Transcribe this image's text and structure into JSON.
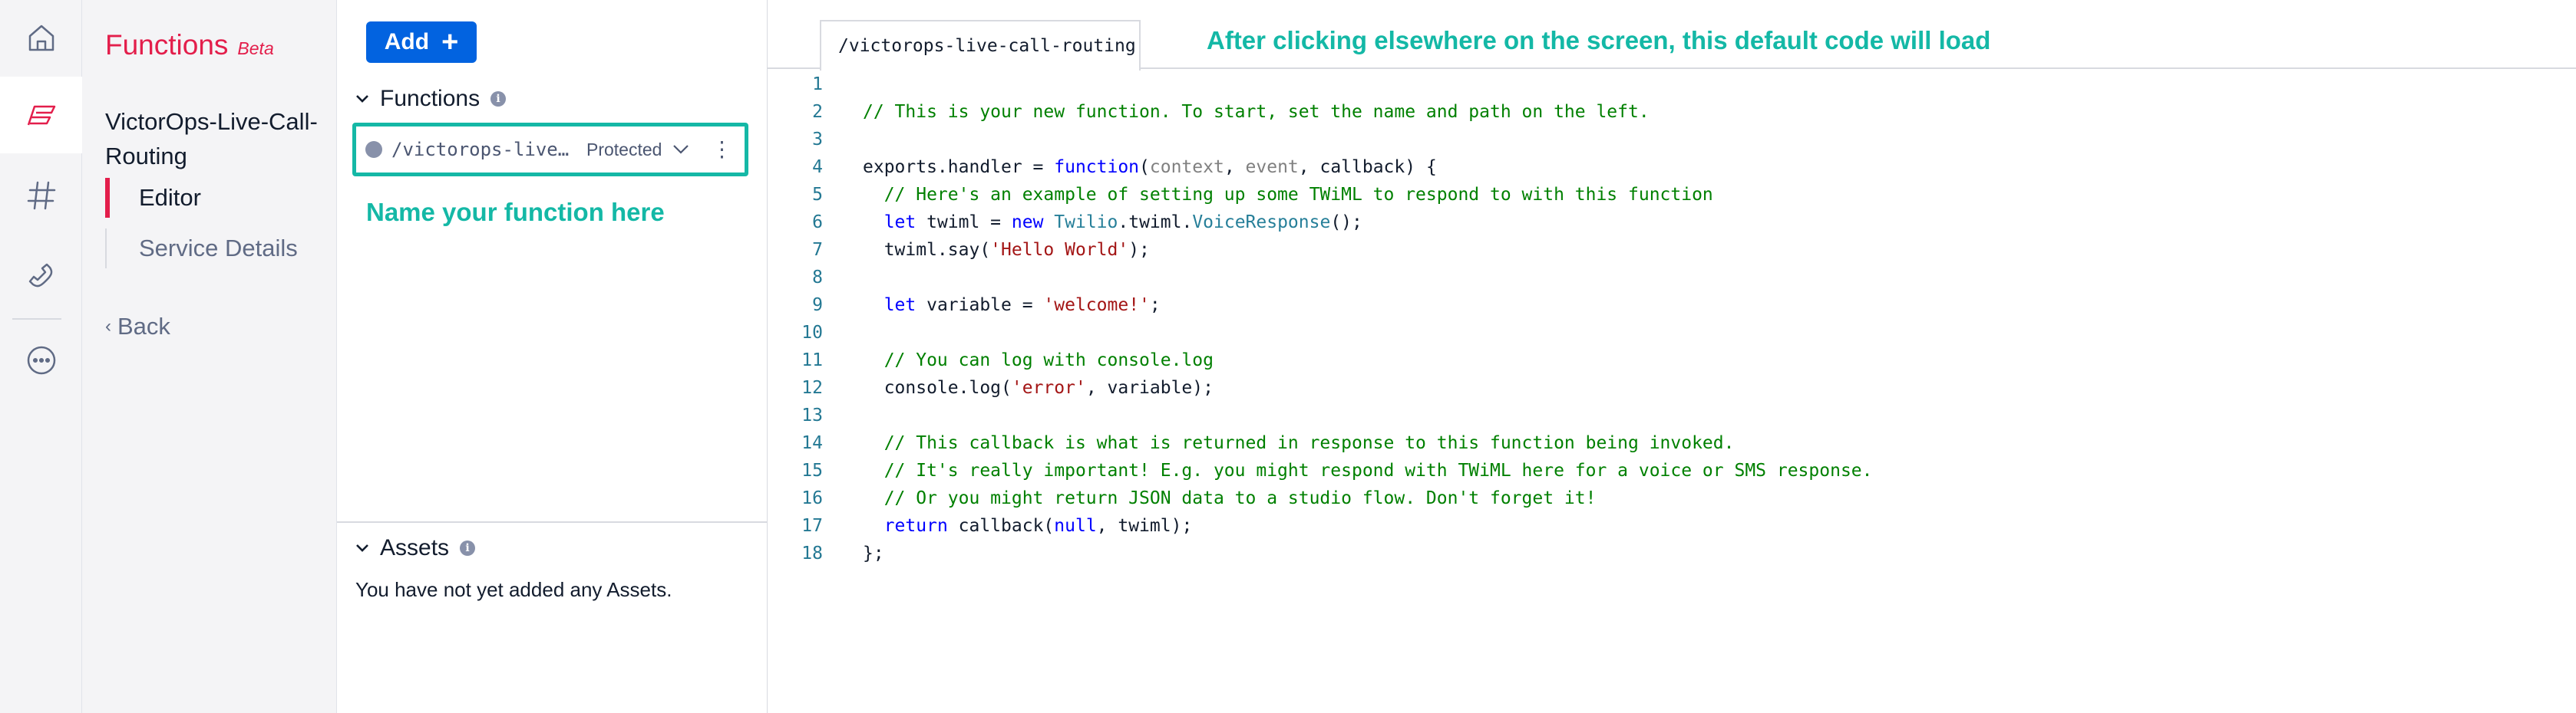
{
  "rail": {
    "items": [
      {
        "icon": "home-icon"
      },
      {
        "icon": "functions-icon",
        "active": true
      },
      {
        "icon": "hash-icon"
      },
      {
        "icon": "phone-icon"
      },
      {
        "icon": "more-icon"
      }
    ]
  },
  "sidebar": {
    "product_name": "Functions",
    "badge": "Beta",
    "service_name": "VictorOps-Live-Call-Routing",
    "nav": [
      {
        "label": "Editor",
        "active": true
      },
      {
        "label": "Service Details",
        "active": false
      }
    ],
    "back_label": "Back"
  },
  "functions_pane": {
    "add_label": "Add",
    "functions_heading": "Functions",
    "function_item": {
      "path": "/victorops-live-call-routing",
      "visibility": "Protected"
    },
    "hint": "Name your function here",
    "assets_heading": "Assets",
    "assets_empty": "You have not yet added any Assets."
  },
  "editor": {
    "tab_label": "/victorops-live-call-routing",
    "hint": "After clicking elsewhere on the screen, this default code will load",
    "line_numbers": [
      "1",
      "2",
      "3",
      "4",
      "5",
      "6",
      "7",
      "8",
      "9",
      "10",
      "11",
      "12",
      "13",
      "14",
      "15",
      "16",
      "17",
      "18"
    ],
    "lines": [
      [],
      [
        [
          "c",
          "// This is your new function. To start, set the name and path on the left."
        ]
      ],
      [],
      [
        [
          "",
          "exports.handler = "
        ],
        [
          "k",
          "function"
        ],
        [
          "",
          "("
        ],
        [
          "p",
          "context"
        ],
        [
          "",
          ", "
        ],
        [
          "p",
          "event"
        ],
        [
          "",
          ", callback) {"
        ]
      ],
      [
        [
          "c",
          "  // Here's an example of setting up some TWiML to respond to with this function"
        ]
      ],
      [
        [
          "",
          "  "
        ],
        [
          "k",
          "let"
        ],
        [
          "",
          " twiml = "
        ],
        [
          "k",
          "new"
        ],
        [
          "",
          " "
        ],
        [
          "t",
          "Twilio"
        ],
        [
          "",
          ".twiml."
        ],
        [
          "t",
          "VoiceResponse"
        ],
        [
          "",
          "();"
        ]
      ],
      [
        [
          "",
          "  twiml.say("
        ],
        [
          "s",
          "'Hello World'"
        ],
        [
          "",
          ");"
        ]
      ],
      [],
      [
        [
          "",
          "  "
        ],
        [
          "k",
          "let"
        ],
        [
          "",
          " variable = "
        ],
        [
          "s",
          "'welcome!'"
        ],
        [
          "",
          ";"
        ]
      ],
      [],
      [
        [
          "c",
          "  // You can log with console.log"
        ]
      ],
      [
        [
          "",
          "  console.log("
        ],
        [
          "s",
          "'error'"
        ],
        [
          "",
          ", variable);"
        ]
      ],
      [],
      [
        [
          "c",
          "  // This callback is what is returned in response to this function being invoked."
        ]
      ],
      [
        [
          "c",
          "  // It's really important! E.g. you might respond with TWiML here for a voice or SMS response."
        ]
      ],
      [
        [
          "c",
          "  // Or you might return JSON data to a studio flow. Don't forget it!"
        ]
      ],
      [
        [
          "",
          "  "
        ],
        [
          "k",
          "return"
        ],
        [
          "",
          " callback("
        ],
        [
          "k",
          "null"
        ],
        [
          "",
          ", twiml);"
        ]
      ],
      [
        [
          "",
          "};"
        ]
      ]
    ]
  }
}
